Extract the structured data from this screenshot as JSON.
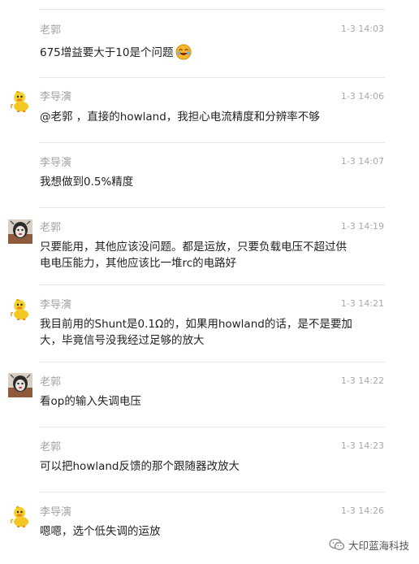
{
  "messages": [
    {
      "sender": "老郭",
      "time": "1-3 14:03",
      "lines": [
        "675增益要大于10是个问题"
      ],
      "emoji": "laugh-emoji",
      "avatar": "none"
    },
    {
      "sender": "李导演",
      "time": "1-3 14:06",
      "lines": [
        "@老郭 ，直接的howland，我担心电流精度和分辨率不够"
      ],
      "avatar": "duck"
    },
    {
      "sender": "李导演",
      "time": "1-3 14:07",
      "lines": [
        "我想做到0.5%精度"
      ],
      "avatar": "none"
    },
    {
      "sender": "老郭",
      "time": "1-3 14:19",
      "lines": [
        "只要能用，其他应该没问题。都是运放，只要负载电压不超过供",
        "电电压能力，其他应该比一堆rc的电路好"
      ],
      "avatar": "photo"
    },
    {
      "sender": "李导演",
      "time": "1-3 14:21",
      "lines": [
        "我目前用的Shunt是0.1Ω的，如果用howland的话，是不是要加",
        "大，毕竟信号没我经过足够的放大"
      ],
      "avatar": "duck"
    },
    {
      "sender": "老郭",
      "time": "1-3 14:22",
      "lines": [
        "看op的输入失调电压"
      ],
      "avatar": "photo"
    },
    {
      "sender": "老郭",
      "time": "1-3 14:23",
      "lines": [
        "可以把howland反馈的那个跟随器改放大"
      ],
      "avatar": "none"
    },
    {
      "sender": "李导演",
      "time": "1-3 14:26",
      "lines": [
        "嗯嗯，选个低失调的运放"
      ],
      "avatar": "duck"
    }
  ],
  "watermark": {
    "text": "大印蓝海科技",
    "icon": "wechat-icon"
  }
}
